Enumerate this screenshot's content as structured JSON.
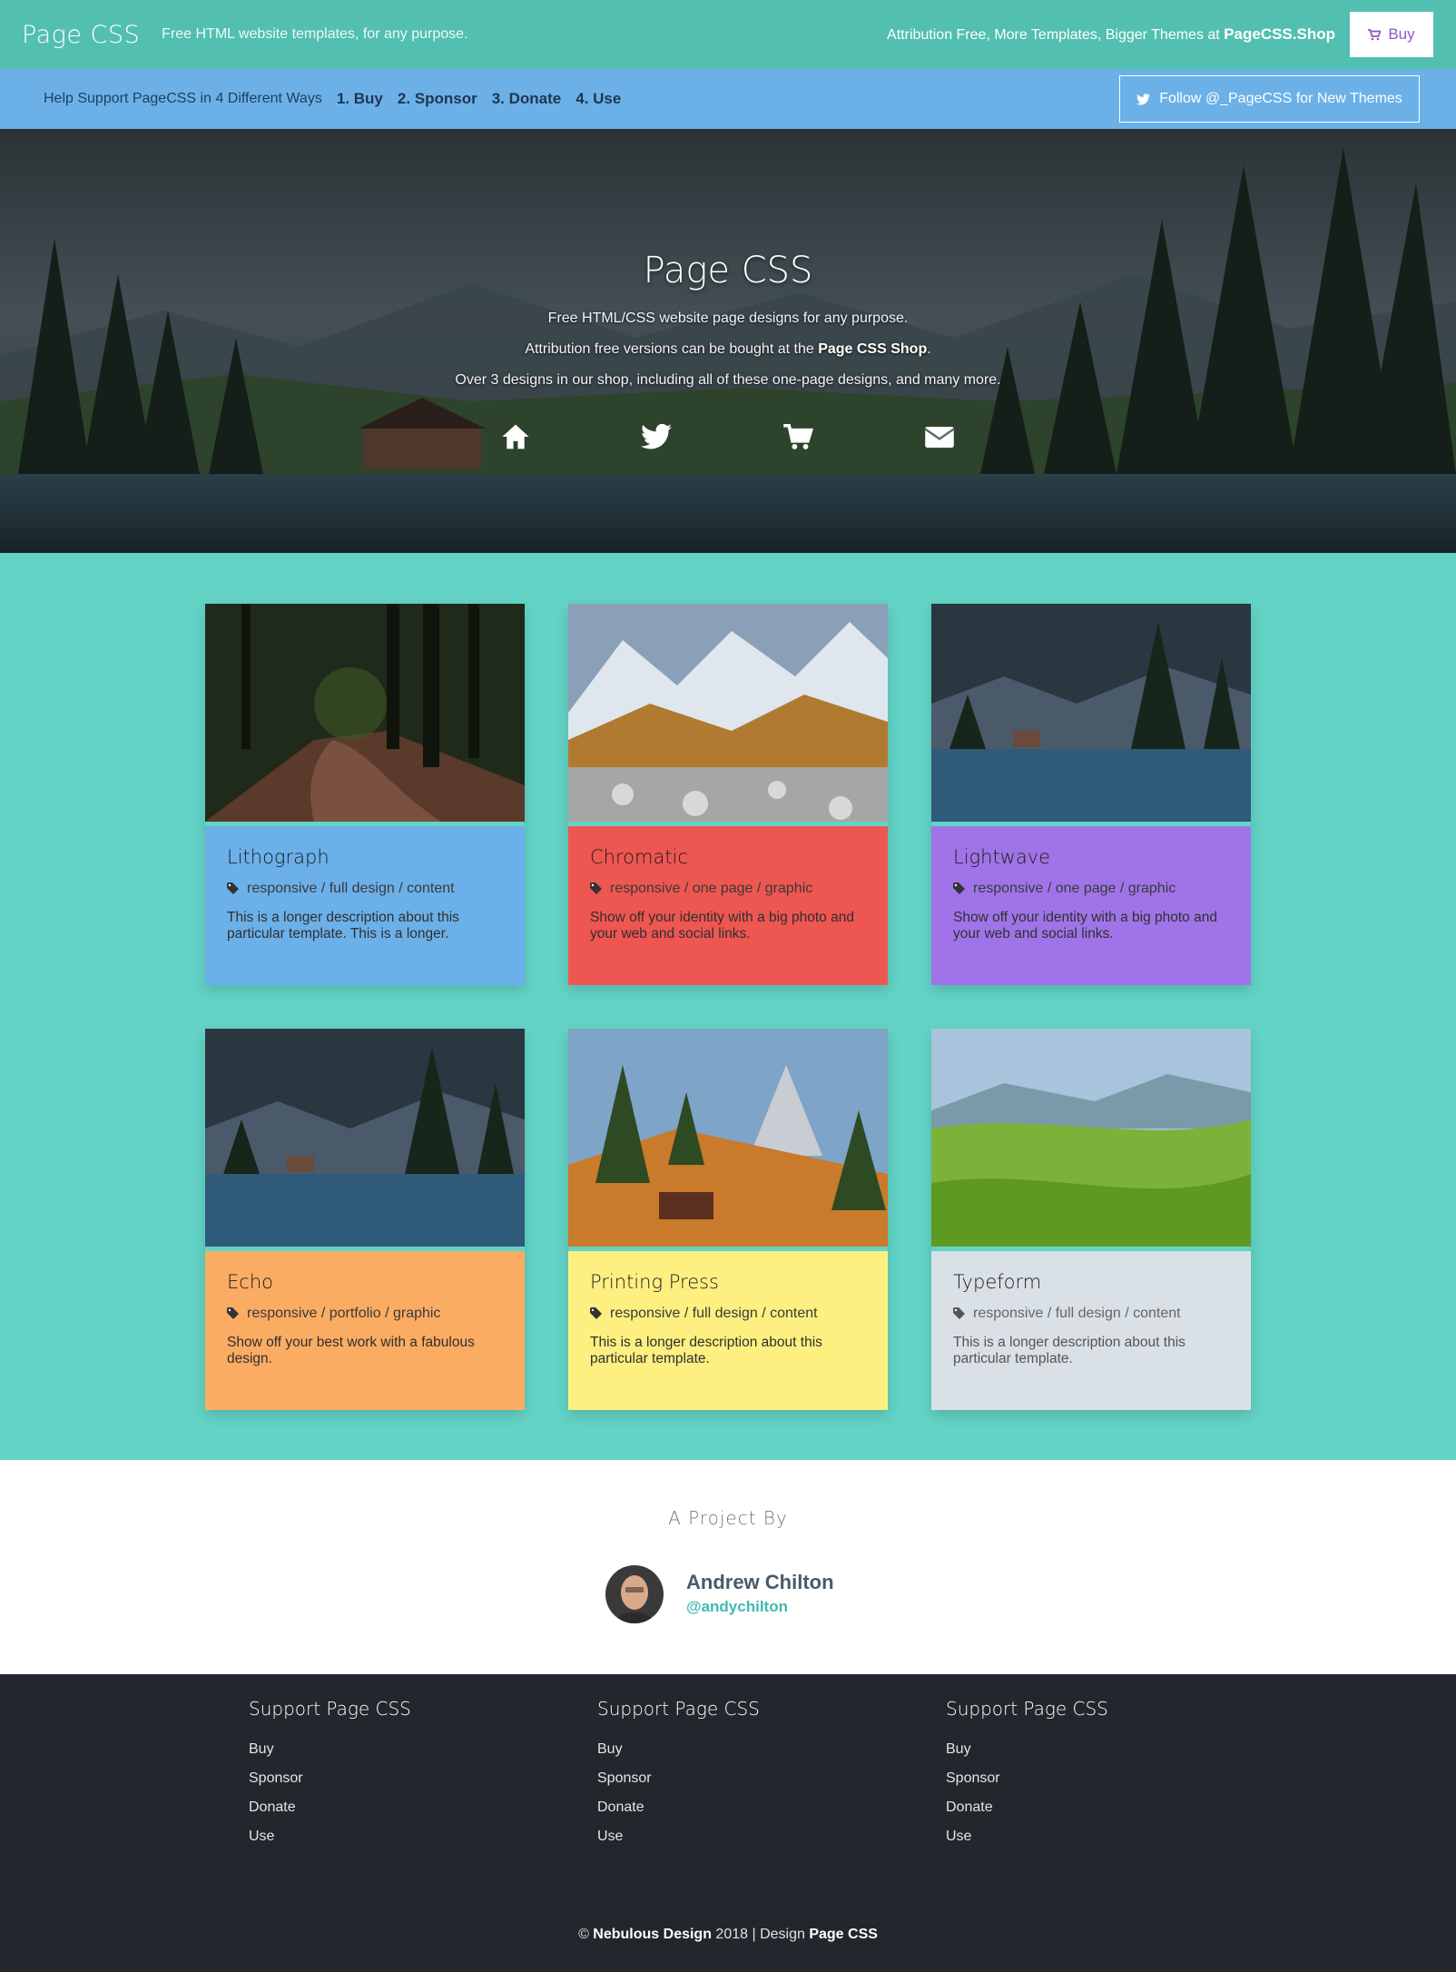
{
  "topbar": {
    "brand": "Page CSS",
    "tagline": "Free HTML website templates, for any purpose.",
    "promo_text": "Attribution Free, More Templates, Bigger Themes at ",
    "promo_link": "PageCSS.Shop",
    "buy_label": "Buy"
  },
  "supportbar": {
    "label": "Help Support PageCSS in 4 Different Ways",
    "links": [
      "1. Buy",
      "2. Sponsor",
      "3. Donate",
      "4. Use"
    ],
    "follow_label": "Follow @_PageCSS for New Themes"
  },
  "hero": {
    "title": "Page CSS",
    "line1": "Free HTML/CSS website page designs for any purpose.",
    "line2_pre": "Attribution free versions can be bought at the ",
    "line2_link": "Page CSS Shop",
    "line2_post": ".",
    "line3": "Over 3 designs in our shop, including all of these one-page designs, and many more.",
    "icons": [
      "home-icon",
      "twitter-icon",
      "cart-icon",
      "envelope-icon"
    ]
  },
  "cards": [
    {
      "title": "Lithograph",
      "tags": "responsive / full design / content",
      "desc": "This is a longer description about this particular template. This is a longer.",
      "color": "#6bb0e8"
    },
    {
      "title": "Chromatic",
      "tags": "responsive / one page / graphic",
      "desc": "Show off your identity with a big photo and your web and social links.",
      "color": "#ee5651"
    },
    {
      "title": "Lightwave",
      "tags": "responsive / one page / graphic",
      "desc": "Show off your identity with a big photo and your web and social links.",
      "color": "#a074e8"
    },
    {
      "title": "Echo",
      "tags": "responsive / portfolio / graphic",
      "desc": "Show off your best work with a fabulous design.",
      "color": "#fbac63"
    },
    {
      "title": "Printing Press",
      "tags": "responsive / full design / content",
      "desc": "This is a longer description about this particular template.",
      "color": "#fdf081"
    },
    {
      "title": "Typeform",
      "tags": "responsive / full design / content",
      "desc": "This is a longer description about this particular template.",
      "color": "#d9e0e6"
    }
  ],
  "project": {
    "label": "A Project By",
    "author_name": "Andrew Chilton",
    "author_handle": "@andychilton"
  },
  "footer": {
    "columns": [
      {
        "title": "Support Page CSS",
        "items": [
          "Buy",
          "Sponsor",
          "Donate",
          "Use"
        ]
      },
      {
        "title": "Support Page CSS",
        "items": [
          "Buy",
          "Sponsor",
          "Donate",
          "Use"
        ]
      },
      {
        "title": "Support Page CSS",
        "items": [
          "Buy",
          "Sponsor",
          "Donate",
          "Use"
        ]
      }
    ],
    "copyright_pre": "© ",
    "copyright_company": "Nebulous Design",
    "copyright_mid": " 2018 | Design ",
    "copyright_brand": "Page CSS"
  }
}
